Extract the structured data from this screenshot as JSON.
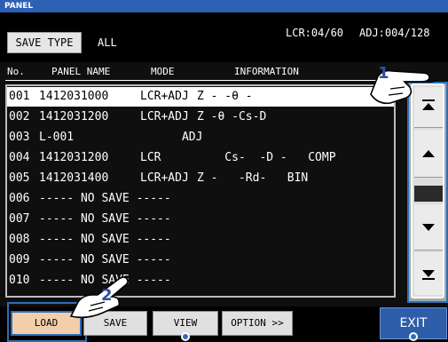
{
  "title": "PANEL",
  "header": {
    "save_type_label": "SAVE TYPE",
    "save_type_value": "ALL",
    "lcr_counter": "LCR:04/60",
    "adj_counter": "ADJ:004/128"
  },
  "columns": {
    "no": "No.",
    "name": "PANEL NAME",
    "mode": "MODE",
    "info": "INFORMATION"
  },
  "rows": [
    {
      "no": "001",
      "name": "1412031000",
      "mode": "LCR+ADJ",
      "info": "Z -   -θ -",
      "selected": true
    },
    {
      "no": "002",
      "name": "1412031200",
      "mode": "LCR+ADJ",
      "info": "Z -θ -Cs-D"
    },
    {
      "no": "003",
      "name": "L-001",
      "mode": "      ADJ",
      "info": ""
    },
    {
      "no": "004",
      "name": "1412031200",
      "mode": "LCR",
      "info": "    Cs-  -D -   COMP"
    },
    {
      "no": "005",
      "name": "1412031400",
      "mode": "LCR+ADJ",
      "info": "Z -   -Rd-   BIN"
    },
    {
      "no": "006",
      "name": "----- NO SAVE -----",
      "mode": "",
      "info": ""
    },
    {
      "no": "007",
      "name": "----- NO SAVE -----",
      "mode": "",
      "info": ""
    },
    {
      "no": "008",
      "name": "----- NO SAVE -----",
      "mode": "",
      "info": ""
    },
    {
      "no": "009",
      "name": "----- NO SAVE -----",
      "mode": "",
      "info": ""
    },
    {
      "no": "010",
      "name": "----- NO SAVE -----",
      "mode": "",
      "info": ""
    }
  ],
  "buttons": {
    "load": "LOAD",
    "save": "SAVE",
    "view": "VIEW",
    "option": "OPTION >>",
    "exit": "EXIT"
  },
  "callouts": {
    "one": "1",
    "two": "2"
  },
  "colors": {
    "title_bar": "#2d5fb4",
    "accent": "#2d6fb8",
    "load_highlight": "#f2cfaa",
    "exit_button": "#2e5da9",
    "scroll_panel": "#a7a7a7"
  },
  "icons": {
    "scroll_top": "triangle-up-bar-icon",
    "page_up": "triangle-up-icon",
    "page_down": "triangle-down-icon",
    "scroll_bottom": "triangle-down-bar-icon",
    "pointer": "pointing-hand-icon"
  }
}
